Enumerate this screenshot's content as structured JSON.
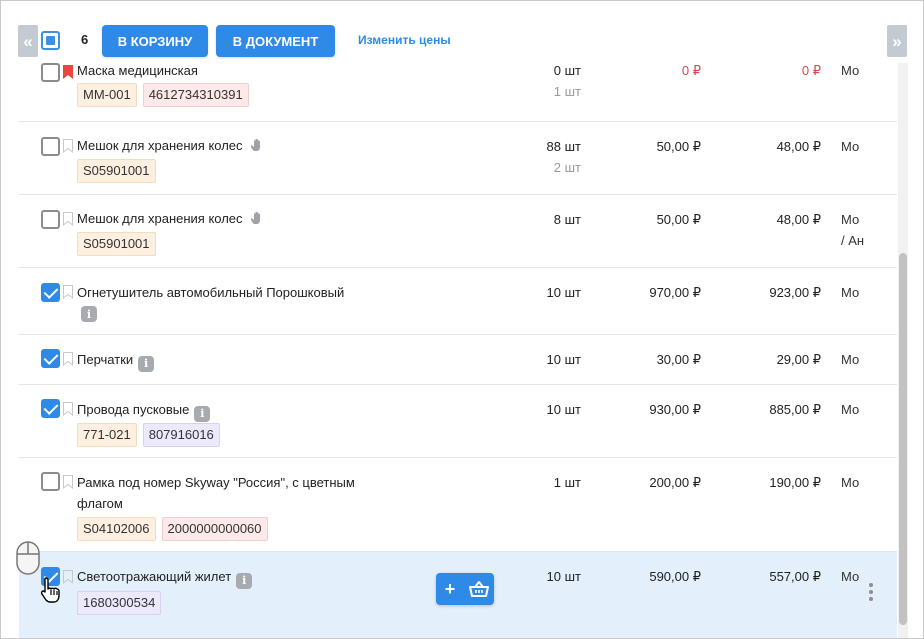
{
  "toolbar": {
    "selected_count": "6",
    "to_cart_label": "В КОРЗИНУ",
    "to_document_label": "В ДОКУМЕНТ",
    "change_prices_label": "Изменить цены",
    "nav_left_icon": "double-chevron-left-icon",
    "nav_right_icon": "double-chevron-right-icon"
  },
  "colors": {
    "accent": "#2e8ae6",
    "bookmark_active": "#e8463e",
    "negative_price": "#e0454f",
    "highlight_row": "#e3effb"
  },
  "rows": [
    {
      "name": "Маска медицинская",
      "checked": false,
      "bookmarked": true,
      "tags": [
        {
          "text": "MM-001",
          "color": "orange"
        },
        {
          "text": "4612734310391",
          "color": "pink"
        }
      ],
      "qty": "0 шт",
      "qty_secondary": "1 шт",
      "price": "0 ₽",
      "price2": "0 ₽",
      "warehouse": "Мо"
    },
    {
      "name": "Мешок для хранения колес",
      "checked": false,
      "bookmarked": false,
      "hand_icon": true,
      "tags": [
        {
          "text": "S05901001",
          "color": "orange"
        }
      ],
      "qty": "88 шт",
      "qty_secondary": "2 шт",
      "price": "50,00 ₽",
      "price2": "48,00 ₽",
      "warehouse": "Мо"
    },
    {
      "name": "Мешок для хранения колес",
      "checked": false,
      "bookmarked": false,
      "hand_icon": true,
      "tags": [
        {
          "text": "S05901001",
          "color": "orange"
        }
      ],
      "qty": "8 шт",
      "price": "50,00 ₽",
      "price2": "48,00 ₽",
      "warehouse": "Мо",
      "warehouse_line2": "/ Ан"
    },
    {
      "name": "Огнетушитель автомобильный Порошковый",
      "checked": true,
      "bookmarked": false,
      "info_icon": true,
      "qty": "10 шт",
      "price": "970,00 ₽",
      "price2": "923,00 ₽",
      "warehouse": "Мо"
    },
    {
      "name": "Перчатки",
      "checked": true,
      "bookmarked": false,
      "info_icon": true,
      "qty": "10 шт",
      "price": "30,00 ₽",
      "price2": "29,00 ₽",
      "warehouse": "Мо"
    },
    {
      "name": "Провода пусковые",
      "checked": true,
      "bookmarked": false,
      "info_icon": true,
      "tags": [
        {
          "text": "771-021",
          "color": "orange"
        },
        {
          "text": "807916016",
          "color": "purple"
        }
      ],
      "qty": "10 шт",
      "price": "930,00 ₽",
      "price2": "885,00 ₽",
      "warehouse": "Мо"
    },
    {
      "name": "Рамка под номер Skyway \"Россия\", с цветным",
      "name_line2": "флагом",
      "checked": false,
      "bookmarked": false,
      "tags": [
        {
          "text": "S04102006",
          "color": "orange"
        },
        {
          "text": "2000000000060",
          "color": "pink"
        }
      ],
      "qty": "1 шт",
      "price": "200,00 ₽",
      "price2": "190,00 ₽",
      "warehouse": "Мо"
    },
    {
      "name": "Светоотражающий жилет",
      "checked": true,
      "bookmarked": false,
      "info_icon": true,
      "highlighted": true,
      "tags": [
        {
          "text": "1680300534",
          "color": "purple"
        }
      ],
      "qty": "10 шт",
      "price": "590,00 ₽",
      "price2": "557,00 ₽",
      "warehouse": "Мо",
      "actions": {
        "add_icon": "plus-icon",
        "cart_icon": "basket-icon"
      }
    }
  ]
}
